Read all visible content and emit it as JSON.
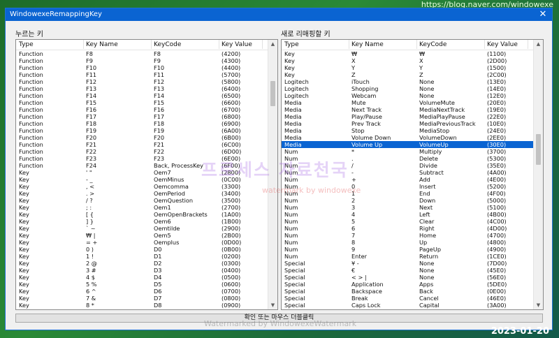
{
  "blog_url": "https://blog.naver.com/windowexe",
  "date_stamp": "2023-01-20",
  "window": {
    "title": "WindowexeRemappingKey",
    "close_glyph": "✕"
  },
  "left_panel": {
    "label": "누르는 키",
    "columns": [
      "Type",
      "Key Name",
      "KeyCode",
      "Key Value"
    ],
    "selected_index": -1,
    "rows": [
      [
        "Function",
        "F8",
        "F8",
        "(4200)"
      ],
      [
        "Function",
        "F9",
        "F9",
        "(4300)"
      ],
      [
        "Function",
        "F10",
        "F10",
        "(4400)"
      ],
      [
        "Function",
        "F11",
        "F11",
        "(5700)"
      ],
      [
        "Function",
        "F12",
        "F12",
        "(5800)"
      ],
      [
        "Function",
        "F13",
        "F13",
        "(6400)"
      ],
      [
        "Function",
        "F14",
        "F14",
        "(6500)"
      ],
      [
        "Function",
        "F15",
        "F15",
        "(6600)"
      ],
      [
        "Function",
        "F16",
        "F16",
        "(6700)"
      ],
      [
        "Function",
        "F17",
        "F17",
        "(6800)"
      ],
      [
        "Function",
        "F18",
        "F18",
        "(6900)"
      ],
      [
        "Function",
        "F19",
        "F19",
        "(6A00)"
      ],
      [
        "Function",
        "F20",
        "F20",
        "(6B00)"
      ],
      [
        "Function",
        "F21",
        "F21",
        "(6C00)"
      ],
      [
        "Function",
        "F22",
        "F22",
        "(6D00)"
      ],
      [
        "Function",
        "F23",
        "F23",
        "(6E00)"
      ],
      [
        "Function",
        "F24",
        "Back, ProcessKey",
        "(6F00)"
      ],
      [
        "Key",
        "' \"",
        "Oem7",
        "(2800)"
      ],
      [
        "Key",
        "- _",
        "OemMinus",
        "(0C00)"
      ],
      [
        "Key",
        ", <",
        "Oemcomma",
        "(3300)"
      ],
      [
        "Key",
        ". >",
        "OemPeriod",
        "(3400)"
      ],
      [
        "Key",
        "/ ?",
        "OemQuestion",
        "(3500)"
      ],
      [
        "Key",
        "; :",
        "Oem1",
        "(2700)"
      ],
      [
        "Key",
        "[ {",
        "OemOpenBrackets",
        "(1A00)"
      ],
      [
        "Key",
        "] }",
        "Oem6",
        "(1B00)"
      ],
      [
        "Key",
        "` ~",
        "Oemtilde",
        "(2900)"
      ],
      [
        "Key",
        "₩ |",
        "Oem5",
        "(2B00)"
      ],
      [
        "Key",
        "= +",
        "Oemplus",
        "(0D00)"
      ],
      [
        "Key",
        "0 )",
        "D0",
        "(0B00)"
      ],
      [
        "Key",
        "1 !",
        "D1",
        "(0200)"
      ],
      [
        "Key",
        "2 @",
        "D2",
        "(0300)"
      ],
      [
        "Key",
        "3 #",
        "D3",
        "(0400)"
      ],
      [
        "Key",
        "4 $",
        "D4",
        "(0500)"
      ],
      [
        "Key",
        "5 %",
        "D5",
        "(0600)"
      ],
      [
        "Key",
        "6 ^",
        "D6",
        "(0700)"
      ],
      [
        "Key",
        "7 &",
        "D7",
        "(0800)"
      ],
      [
        "Key",
        "8 *",
        "D8",
        "(0900)"
      ]
    ],
    "scroll_thumb": {
      "position": 0.13,
      "size": 0.1
    }
  },
  "right_panel": {
    "label": "새로 리매핑할 키",
    "columns": [
      "Type",
      "Key Name",
      "KeyCode",
      "Key Value"
    ],
    "selected_index": 13,
    "rows": [
      [
        "Key",
        "₩",
        "₩",
        "(1100)"
      ],
      [
        "Key",
        "X",
        "X",
        "(2D00)"
      ],
      [
        "Key",
        "Y",
        "Y",
        "(1500)"
      ],
      [
        "Key",
        "Z",
        "Z",
        "(2C00)"
      ],
      [
        "Logitech",
        "iTouch",
        "None",
        "(13E0)"
      ],
      [
        "Logitech",
        "Shopping",
        "None",
        "(14E0)"
      ],
      [
        "Logitech",
        "Webcam",
        "None",
        "(12E0)"
      ],
      [
        "Media",
        "Mute",
        "VolumeMute",
        "(20E0)"
      ],
      [
        "Media",
        "Next Track",
        "MediaNextTrack",
        "(19E0)"
      ],
      [
        "Media",
        "Play/Pause",
        "MediaPlayPause",
        "(22E0)"
      ],
      [
        "Media",
        "Prev Track",
        "MediaPreviousTrack",
        "(10E0)"
      ],
      [
        "Media",
        "Stop",
        "MediaStop",
        "(24E0)"
      ],
      [
        "Media",
        "Volume Down",
        "VolumeDown",
        "(2EE0)"
      ],
      [
        "Media",
        "Volume Up",
        "VolumeUp",
        "(30E0)"
      ],
      [
        "Num",
        "*",
        "Multiply",
        "(3700)"
      ],
      [
        "Num",
        ".",
        "Delete",
        "(5300)"
      ],
      [
        "Num",
        "/",
        "Divide",
        "(35E0)"
      ],
      [
        "Num",
        "-",
        "Subtract",
        "(4A00)"
      ],
      [
        "Num",
        "+",
        "Add",
        "(4E00)"
      ],
      [
        "Num",
        "0",
        "Insert",
        "(5200)"
      ],
      [
        "Num",
        "1",
        "End",
        "(4F00)"
      ],
      [
        "Num",
        "2",
        "Down",
        "(5000)"
      ],
      [
        "Num",
        "3",
        "Next",
        "(5100)"
      ],
      [
        "Num",
        "4",
        "Left",
        "(4B00)"
      ],
      [
        "Num",
        "5",
        "Clear",
        "(4C00)"
      ],
      [
        "Num",
        "6",
        "Right",
        "(4D00)"
      ],
      [
        "Num",
        "7",
        "Home",
        "(4700)"
      ],
      [
        "Num",
        "8",
        "Up",
        "(4800)"
      ],
      [
        "Num",
        "9",
        "PageUp",
        "(4900)"
      ],
      [
        "Num",
        "Enter",
        "Return",
        "(1CE0)"
      ],
      [
        "Special",
        "¥ -",
        "None",
        "(7D00)"
      ],
      [
        "Special",
        "€",
        "None",
        "(45E0)"
      ],
      [
        "Special",
        "< > |",
        "None",
        "(56E0)"
      ],
      [
        "Special",
        "Application",
        "Apps",
        "(5DE0)"
      ],
      [
        "Special",
        "Backspace",
        "Back",
        "(0E00)"
      ],
      [
        "Special",
        "Break",
        "Cancel",
        "(46E0)"
      ],
      [
        "Special",
        "Caps Lock",
        "Capital",
        "(3A00)"
      ]
    ],
    "scroll_thumb": {
      "position": 0.34,
      "size": 0.12
    }
  },
  "confirm_button": "확인 또는 마우스 더블클릭",
  "watermarks": {
    "center": "프로세스 자료천국",
    "small": "watermark by windowexe",
    "bottom": "Watermarked by WindowexeWatermark"
  }
}
